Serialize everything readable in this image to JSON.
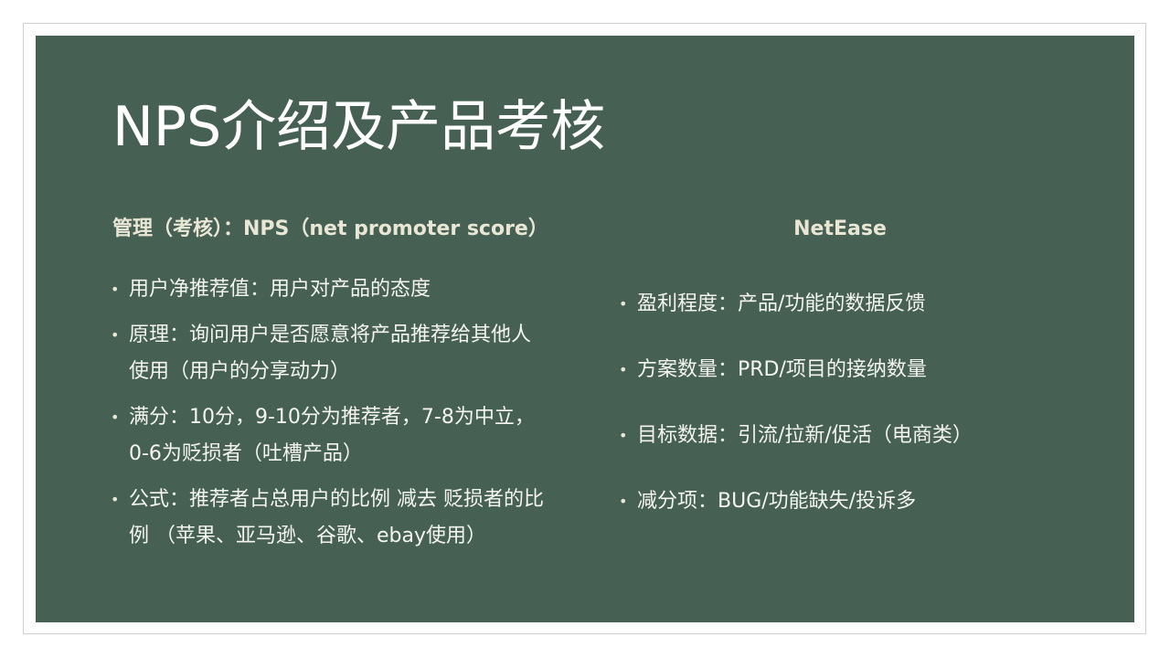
{
  "slide": {
    "title": "NPS介绍及产品考核",
    "left_column": {
      "heading": "管理（考核）：NPS（net promoter score）",
      "bullets": [
        "用户净推荐值：用户对产品的态度",
        "原理：询问用户是否愿意将产品推荐给其他人使用（用户的分享动力）",
        "满分：10分，9-10分为推荐者，7-8为中立，0-6为贬损者（吐槽产品）",
        "公式：推荐者占总用户的比例   减去   贬损者的比例    （苹果、亚马逊、谷歌、ebay使用）"
      ]
    },
    "right_column": {
      "heading": "NetEase",
      "bullets": [
        "盈利程度：产品/功能的数据反馈",
        "方案数量：PRD/项目的接纳数量",
        "目标数据：引流/拉新/促活（电商类）",
        "减分项：BUG/功能缺失/投诉多"
      ]
    }
  },
  "colors": {
    "slide_background": "#466153",
    "heading_text": "#e9e6d6",
    "body_text": "#f4f4f0"
  }
}
